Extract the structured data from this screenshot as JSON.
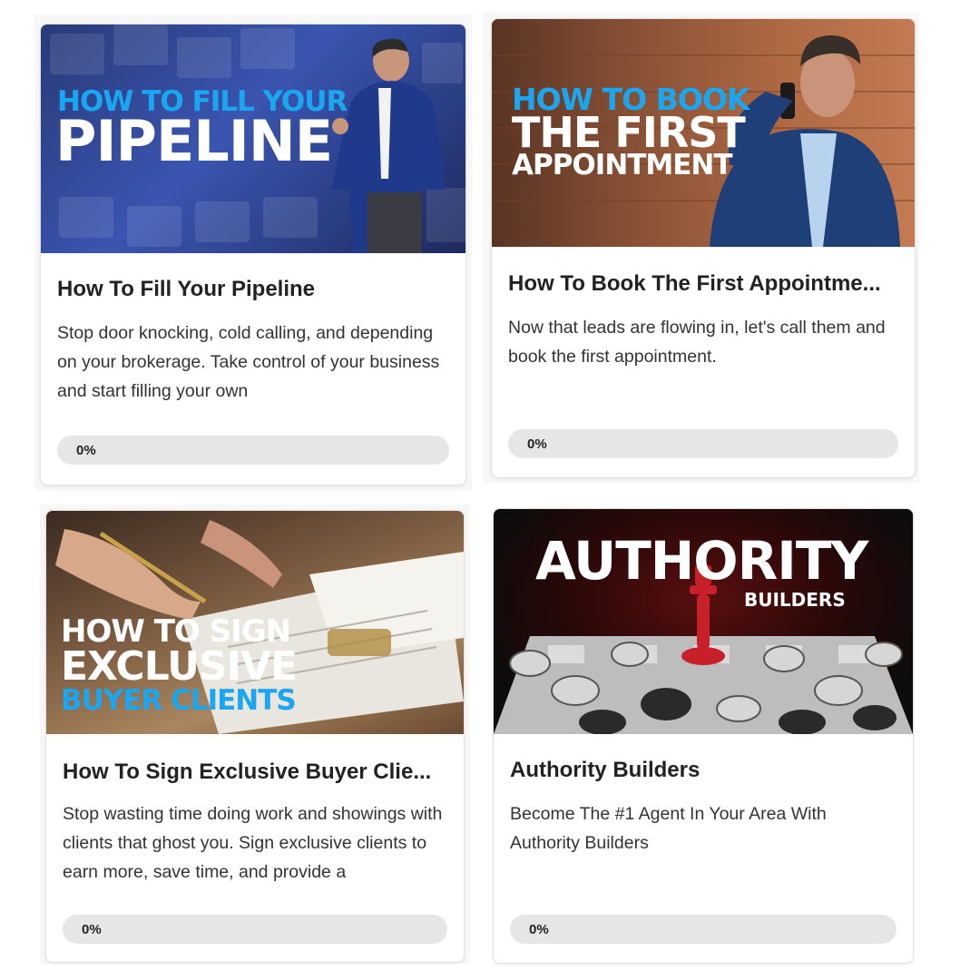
{
  "colors": {
    "blue": "#1aa6f0",
    "white": "#ffffff",
    "track": "#e6e6e6"
  },
  "courses": [
    {
      "thumb_lines": [
        "HOW TO FILL YOUR",
        "PIPELINE"
      ],
      "title": "How To Fill Your Pipeline",
      "description": "Stop door knocking, cold calling, and depending on your brokerage. Take control of your business and start filling your own",
      "progress": 0,
      "progress_label": "0%"
    },
    {
      "thumb_lines": [
        "HOW TO BOOK",
        "THE FIRST",
        "APPOINTMENT"
      ],
      "title": "How To Book The First Appointme...",
      "description": "Now that leads are flowing in, let's call them and book the first appointment.",
      "progress": 0,
      "progress_label": "0%"
    },
    {
      "thumb_lines": [
        "HOW TO SIGN",
        "EXCLUSIVE",
        "BUYER CLIENTS"
      ],
      "title": "How To Sign Exclusive Buyer Clie...",
      "description": "Stop wasting time doing work and showings with clients that ghost you. Sign exclusive clients to earn more, save time, and provide a",
      "progress": 0,
      "progress_label": "0%"
    },
    {
      "thumb_lines": [
        "AUTHORITY",
        "BUILDERS"
      ],
      "title": "Authority Builders",
      "description": "Become The #1 Agent In Your Area With Authority Builders",
      "progress": 0,
      "progress_label": "0%"
    }
  ]
}
